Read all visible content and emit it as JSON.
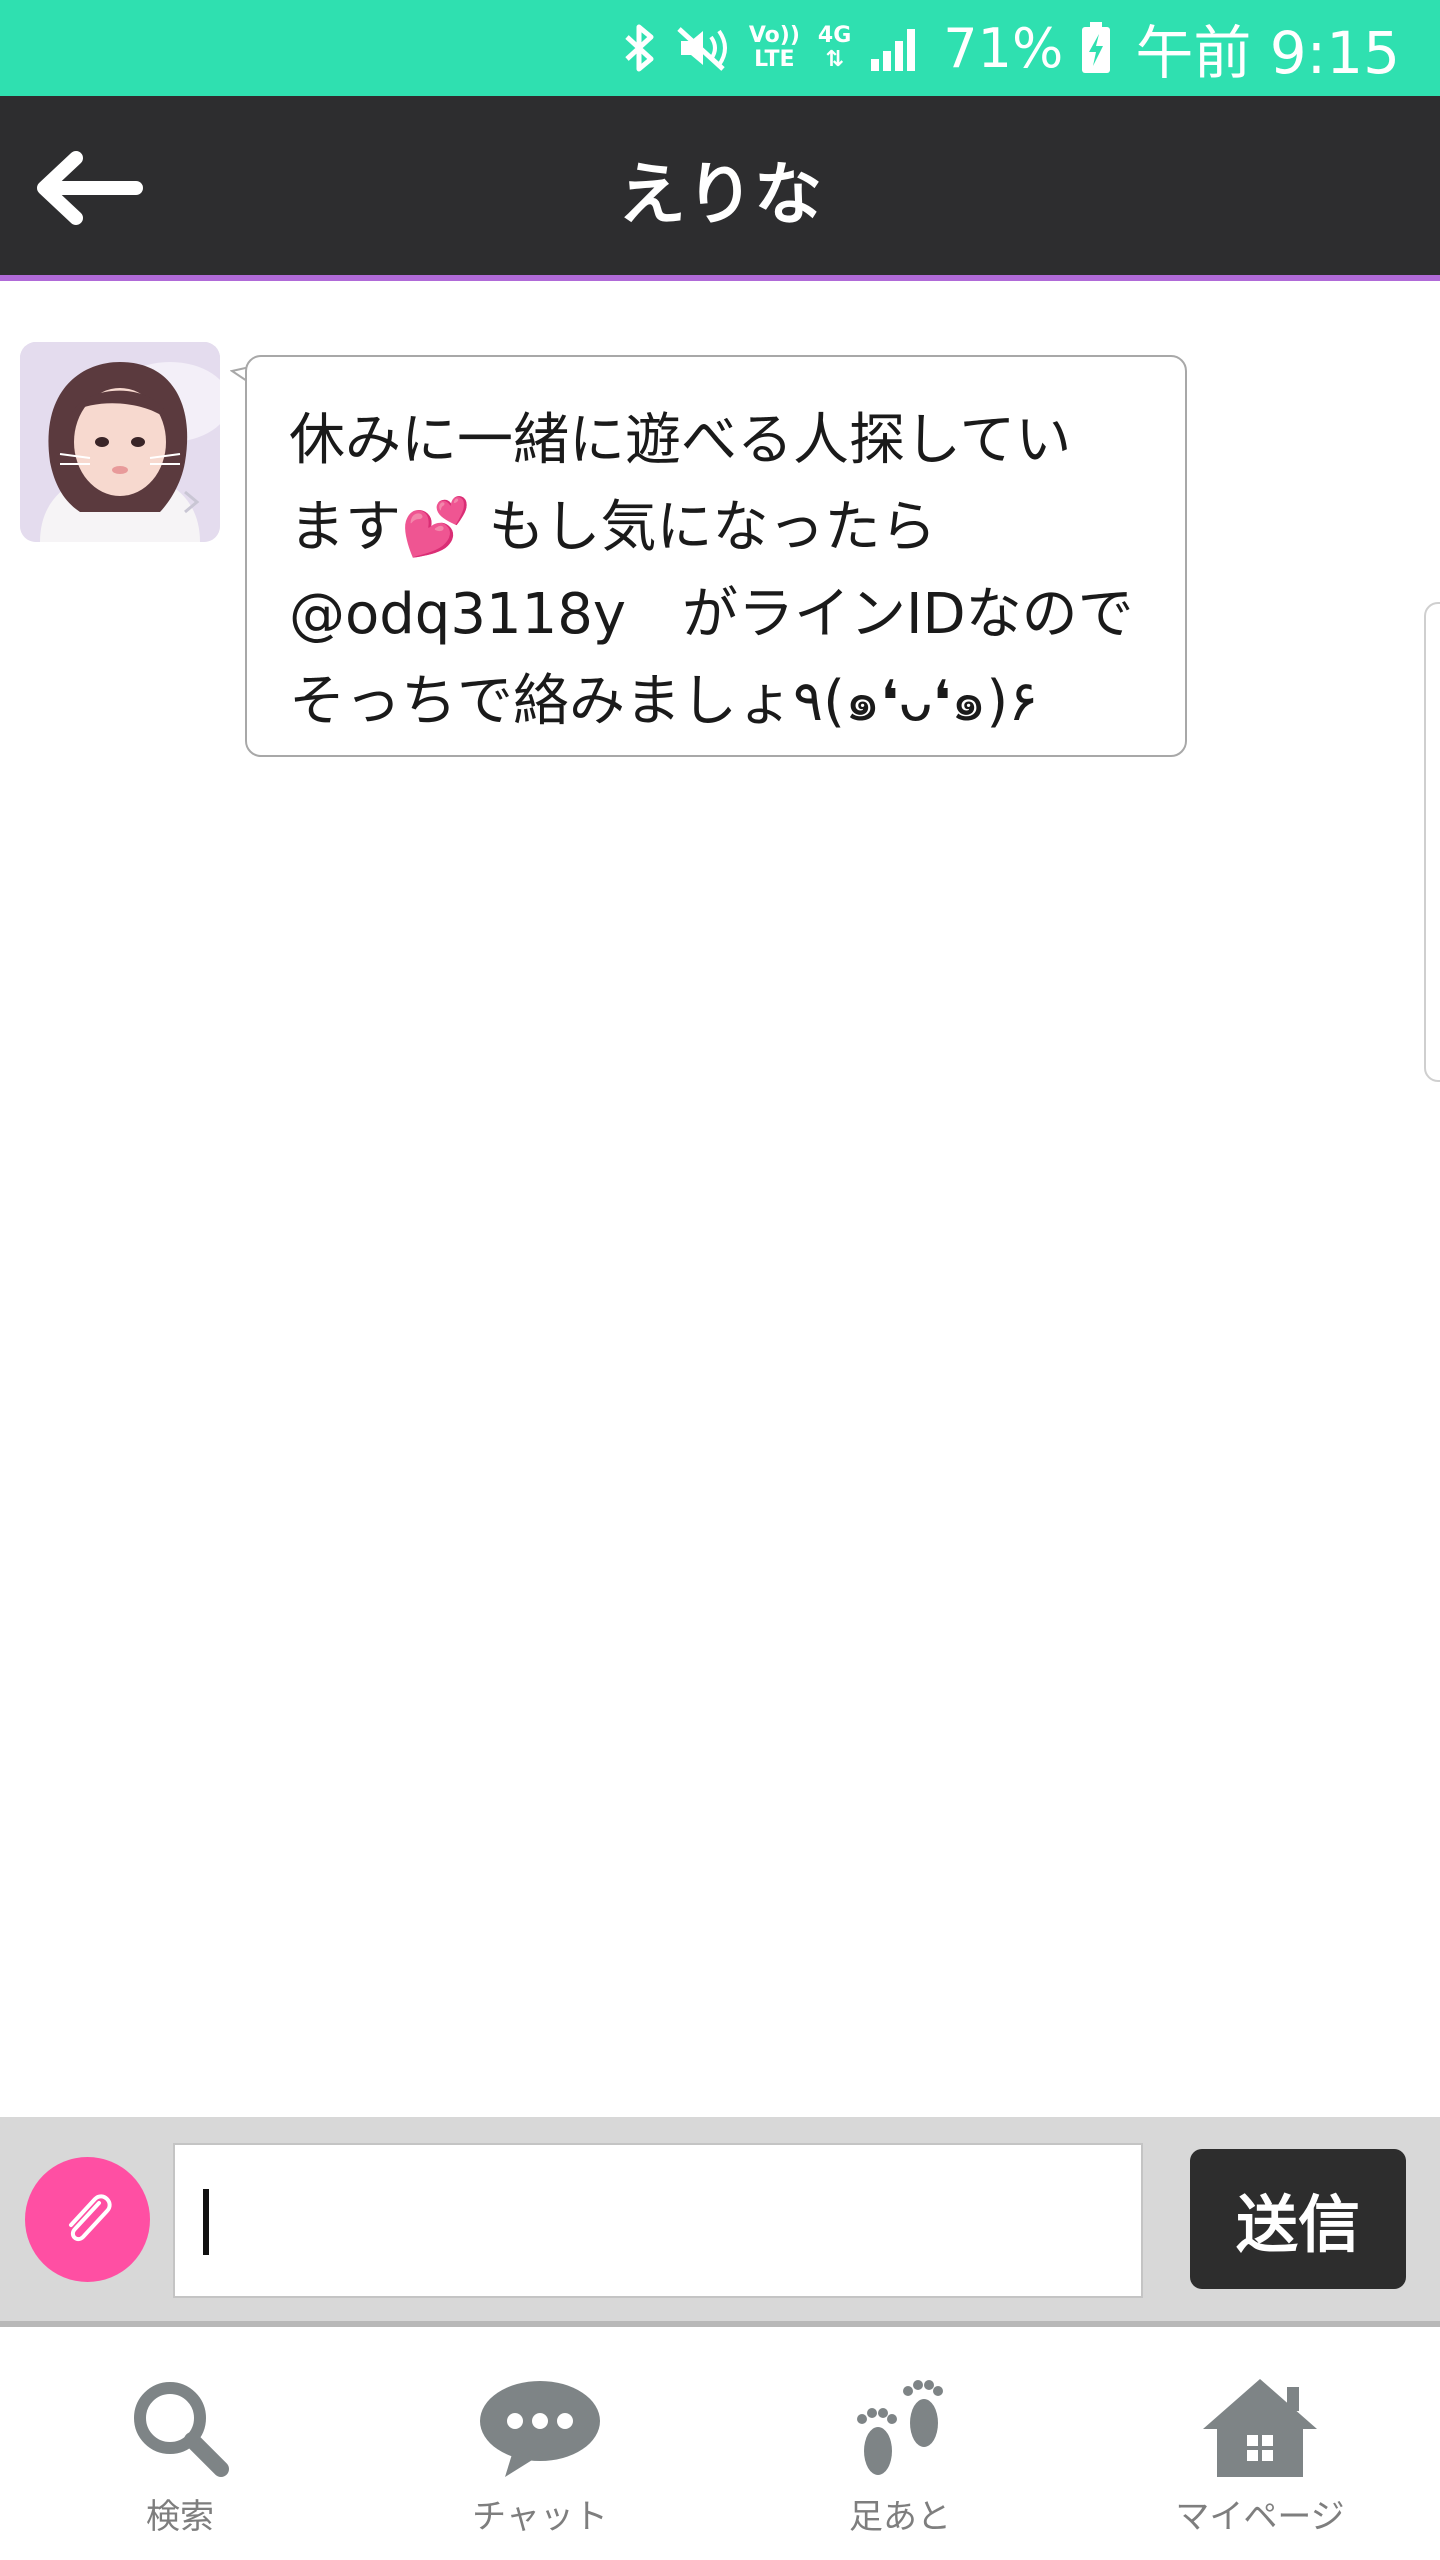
{
  "status_bar": {
    "volte_label": "Vo))\nLTE",
    "network_label": "4G",
    "battery_percent": "71%",
    "time": "午前 9:15"
  },
  "header": {
    "title": "えりな"
  },
  "conversation": {
    "messages": [
      {
        "sender": "えりな",
        "text": "休みに一緒に遊べる人探してい\nます💕 もし気になったら\n@odq3118y　がラインIDなので\nそっちで絡みましょ٩(๑❛ᴗ❛๑)۶"
      }
    ]
  },
  "composer": {
    "input_value": "",
    "send_label": "送信"
  },
  "bottom_nav": {
    "items": [
      {
        "label": "検索",
        "icon": "search-icon"
      },
      {
        "label": "チャット",
        "icon": "chat-icon"
      },
      {
        "label": "足あと",
        "icon": "footprints-icon"
      },
      {
        "label": "マイページ",
        "icon": "home-icon"
      }
    ]
  },
  "colors": {
    "status_bar": "#2fe0b0",
    "header": "#2d2d2f",
    "attach_button": "#ff4fa3",
    "send_button": "#2d2d2d",
    "nav_icon": "#7e8486"
  }
}
